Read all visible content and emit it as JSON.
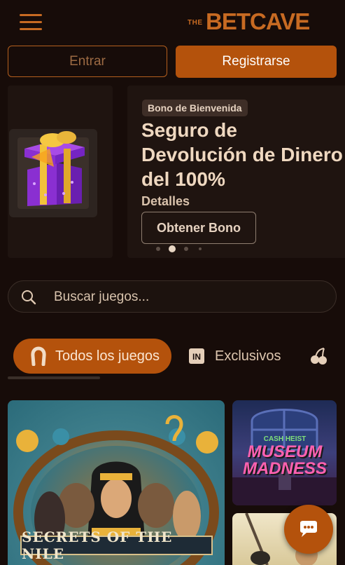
{
  "header": {
    "menu_icon": "hamburger-menu-icon",
    "logo_prefix": "THE",
    "logo_word": "BETCAVE"
  },
  "auth": {
    "login_label": "Entrar",
    "register_label": "Registrarse"
  },
  "promo": {
    "badge": "Bono de Bienvenida",
    "title": "Seguro de Devolución de Dinero del 100%",
    "details": "Detalles",
    "cta": "Obtener Bono",
    "prev_slide_icon": "gift-box-icon",
    "slides_total": 4,
    "active_slide": 2
  },
  "search": {
    "placeholder": "Buscar juegos..."
  },
  "tabs": [
    {
      "label": "Todos los juegos",
      "icon": "horseshoe-icon",
      "active": true
    },
    {
      "label": "Exclusivos",
      "icon": "exclusive-badge-icon",
      "active": false
    },
    {
      "label": "",
      "icon": "cherries-icon",
      "active": false
    }
  ],
  "games": {
    "large_title": "SECRETS OF THE NILE",
    "small_1_tag": "CASH HEIST",
    "small_1_title": "MUSEUM MADNESS"
  },
  "chat": {
    "icon": "chat-bubble-icon"
  },
  "colors": {
    "background": "#170c09",
    "accent": "#b4520c",
    "text": "#ead9c8"
  }
}
